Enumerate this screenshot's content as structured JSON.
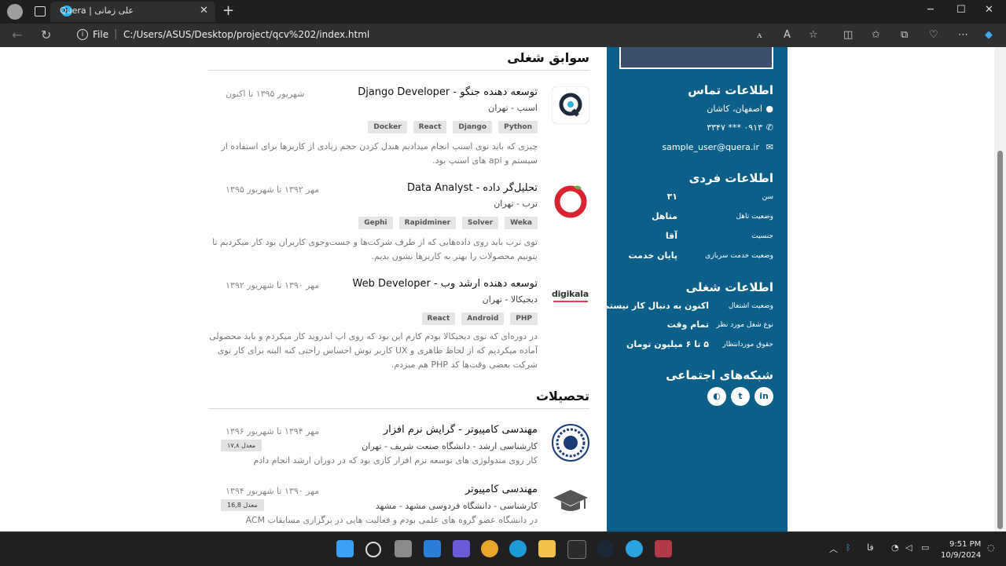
{
  "browser": {
    "tab_title": "علی زمانی | Quera",
    "url_scheme_label": "File",
    "url": "C:/Users/ASUS/Desktop/project/qcv%202/index.html"
  },
  "experience": {
    "section_title": "سوابق شغلی",
    "items": [
      {
        "title": "توسعه دهنده جنگو - Django Developer",
        "date": "شهریور ۱۳۹۵ تا اکنون",
        "company": "اسنپ - تهران",
        "tags": [
          "Python",
          "Django",
          "React",
          "Docker"
        ],
        "description": "چیزی که باید توی اسنپ انجام میدادیم هندل کردن حجم زیادی از کاربرها برای استفاده از سیستم و api های اسنپ بود.",
        "logo_icon": "quera-logo-icon"
      },
      {
        "title": "تحلیل‌گر داده - Data Analyst",
        "date": "مهر ۱۳۹۲ تا شهریور ۱۳۹۵",
        "company": "ترب - تهران",
        "tags": [
          "Weka",
          "Solver",
          "Rapidminer",
          "Gephi"
        ],
        "description": "توی ترب باید روی داده‌هایی که از طرف شرکت‌ها و جست‌وجوی کاربران بود کار میکردیم تا بتونیم محصولات را بهتر به کاربرها نشون بدیم.",
        "logo_icon": "torob-logo-icon"
      },
      {
        "title": "توسعه دهنده ارشد وب - Web Developer",
        "date": "مهر ۱۳۹۰ تا شهریور ۱۳۹۲",
        "company": "دیجیکالا - تهران",
        "tags": [
          "PHP",
          "Android",
          "React"
        ],
        "description": "در دوره‌ای که توی دیجیکالا بودم کارم این بود که روی اپ اندروید کار میکردم و باید محصولی آماده میکردیم که از لحاظ ظاهری و UX کاربر توش احساس راحتی کنه البته برای کار توی شرکت بعضی وقت‌ها کد PHP هم میزدم.",
        "logo_text": "digikala",
        "logo_icon": "digikala-logo-icon"
      }
    ]
  },
  "education": {
    "section_title": "تحصیلات",
    "items": [
      {
        "title": "مهندسی کامپیوتر - گرایش نرم افزار",
        "date": "مهر ۱۳۹۴ تا شهریور ۱۳۹۶",
        "school": "کارشناسی ارشد - دانشگاه صنعت شریف - تهران",
        "grade": "معدل ۱۷,۸",
        "description": "کار روی متدولوژی های توسعه نرم افزار کاری بود که در دوران ارشد انجام دادم",
        "logo_icon": "sharif-university-logo-icon"
      },
      {
        "title": "مهندسی کامپیوتر",
        "date": "مهر ۱۳۹۰ تا شهریور ۱۳۹۴",
        "school": "کارشناسی - دانشگاه فردوسی مشهد - مشهد",
        "grade": "معدل 16,8",
        "description": "در دانشگاه عضو گروه های علمی بودم و فعالیت هایی در برگزاری مسابقات ACM",
        "logo_icon": "graduation-cap-icon"
      }
    ]
  },
  "sidebar": {
    "contact": {
      "title": "اطلاعات تماس",
      "location": "اصفهان، کاشان",
      "phone": "۰۹۱۳ *** ۳۳۴۷",
      "email": "sample_user@quera.ir"
    },
    "personal": {
      "title": "اطلاعات فردی",
      "rows": [
        {
          "label": "سن",
          "value": "۳۱"
        },
        {
          "label": "وضعیت تاهل",
          "value": "متاهل"
        },
        {
          "label": "جنسیت",
          "value": "آقا"
        },
        {
          "label": "وضعیت خدمت سربازی",
          "value": "پایان خدمت"
        }
      ]
    },
    "job": {
      "title": "اطلاعات شغلی",
      "rows": [
        {
          "label": "وضعیت اشتغال",
          "value": "اکنون به دنبال کار نیستم"
        },
        {
          "label": "نوع شغل مورد نظر",
          "value": "تمام وقت"
        },
        {
          "label": "حقوق موردانتظار",
          "value": "۵ تا ۶ میلیون تومان"
        }
      ]
    },
    "social": {
      "title": "شبکه‌های اجتماعی",
      "icons": [
        "linkedin-icon",
        "twitter-icon",
        "github-icon"
      ]
    }
  },
  "taskbar": {
    "language": "فا",
    "time": "9:51 PM",
    "date": "10/9/2024"
  },
  "colors": {
    "sidebar_bg": "#0b5f88",
    "tag_bg": "#e5e5e5"
  }
}
